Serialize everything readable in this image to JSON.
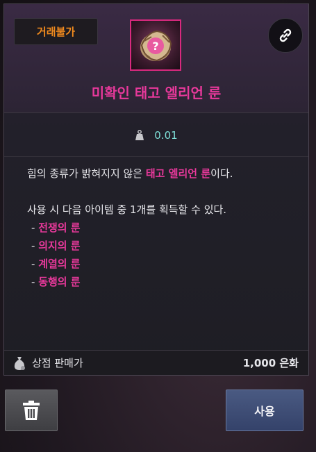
{
  "badge": {
    "label": "거래불가",
    "color": "#f08a1e"
  },
  "item": {
    "name": "미확인 태고 엘리언 룬",
    "name_color": "#e8399b",
    "icon": "mystery-rune-icon",
    "frame_color": "#d8297e"
  },
  "weight": {
    "icon": "weight-icon",
    "value": "0.01"
  },
  "description": {
    "line1_prefix": "힘의 종류가 밝혀지지 않은 ",
    "line1_highlight": "태고 엘리언 룬",
    "line1_suffix": "이다.",
    "line2": "사용 시 다음 아이템 중 1개를 획득할 수 있다.",
    "list_prefix": "- ",
    "items": [
      "전쟁의 룬",
      "의지의 룬",
      "계열의 룬",
      "동행의 룬"
    ]
  },
  "footer": {
    "label": "상점 판매가",
    "price": "1,000 은화",
    "icon": "money-bag-icon"
  },
  "buttons": {
    "trash_icon": "trash-icon",
    "use_label": "사용"
  },
  "link_icon": "link-icon"
}
